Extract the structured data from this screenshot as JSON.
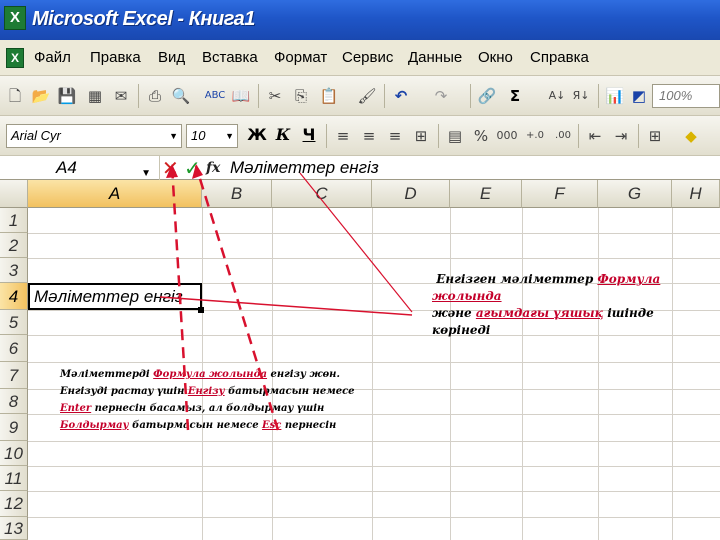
{
  "window": {
    "title": "Microsoft Excel - Книга1",
    "app_icon": "excel-icon",
    "logo_letter": "X"
  },
  "menu": {
    "doc_icon": "excel-doc-icon",
    "items": [
      "Файл",
      "Правка",
      "Вид",
      "Вставка",
      "Формат",
      "Сервис",
      "Данные",
      "Окно",
      "Справка"
    ]
  },
  "toolbar_standard": {
    "buttons": [
      "new-icon",
      "open-icon",
      "save-icon",
      "permission-icon",
      "email-icon",
      "print-icon",
      "print-preview-icon",
      "spelling-icon",
      "research-icon",
      "cut-icon",
      "copy-icon",
      "paste-icon",
      "format-painter-icon",
      "undo-icon",
      "redo-icon",
      "hyperlink-icon",
      "autosum-icon",
      "sort-asc-icon",
      "sort-desc-icon",
      "chart-wizard-icon",
      "drawing-icon"
    ],
    "zoom": "100%"
  },
  "toolbar_formatting": {
    "font": "Arial Cyr",
    "size": "10",
    "bold": "Ж",
    "italic": "К",
    "underline": "Ч",
    "percent": "%",
    "thousands": "000"
  },
  "formula_bar": {
    "name_box": "A4",
    "cancel": "✕",
    "enter": "✓",
    "fx": "fx",
    "content": "Мәліметтер енгіз"
  },
  "sheet": {
    "columns": [
      "A",
      "B",
      "C",
      "D",
      "E",
      "F",
      "G",
      "H"
    ],
    "rows": [
      "1",
      "2",
      "3",
      "4",
      "5",
      "6",
      "7",
      "8",
      "9",
      "10",
      "11",
      "12",
      "13"
    ],
    "active_cell": "A4",
    "a4_value": "Мәліметтер енгіз"
  },
  "annotations": {
    "note1": {
      "p1": "Енгізген мәліметтер ",
      "p1_red": "Формула жолында",
      "p2": "және ",
      "p2_red": "ағымдағы ұяшық",
      "p3": " ішінде көрінеді"
    },
    "note2": {
      "l1a": "Мәліметтерді ",
      "l1_red": "Формула жолында",
      "l1b": " енгізу жөн.",
      "l2a": "Енгізуді растау үшін ",
      "l2_red": "Енгізу",
      "l2b": " батырмасын немесе",
      "l3_red": "Enter",
      "l3b": " пернесін басамыз, ал болдырмау үшін",
      "l4_red": "Болдырмау",
      "l4b": " батырмасын немесе ",
      "l4_red2": "Esc",
      "l4c": " пернесін"
    },
    "arrow_color": "#d8112e",
    "line_color": "#d8112e"
  }
}
